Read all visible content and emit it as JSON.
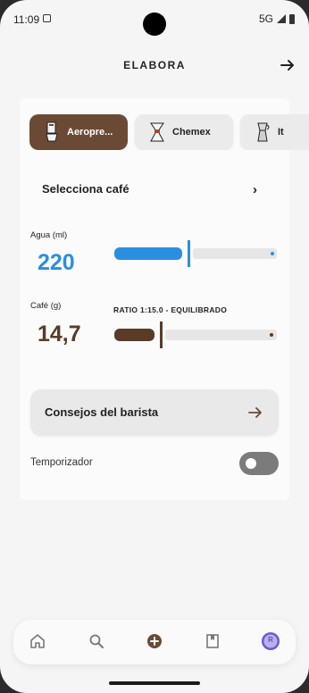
{
  "status_bar": {
    "time": "11:09",
    "network": "5G"
  },
  "header": {
    "title": "ELABORA"
  },
  "methods": [
    {
      "label": "Aeropre...",
      "active": true
    },
    {
      "label": "Chemex",
      "active": false
    },
    {
      "label": "It",
      "active": false
    }
  ],
  "coffee_select": {
    "label": "Selecciona café"
  },
  "water": {
    "label": "Agua (ml)",
    "value": "220",
    "level": 0.45
  },
  "coffee": {
    "label": "Café (g)",
    "value": "14,7",
    "level": 0.28
  },
  "ratio": {
    "text": "RATIO 1:15.0 - EQUILIBRADO"
  },
  "tips": {
    "label": "Consejos del barista"
  },
  "timer": {
    "label": "Temporizador",
    "enabled": false
  },
  "nav": {
    "items": [
      "home-icon",
      "search-icon",
      "add-circle-icon",
      "bookmark-icon",
      "profile-avatar"
    ],
    "avatar_initial": "R"
  },
  "colors": {
    "accent_brown": "#6b4a35",
    "water_blue": "#2a8fe0",
    "coffee_brown": "#5a3b28",
    "avatar_purple": "#6b5bd1"
  }
}
